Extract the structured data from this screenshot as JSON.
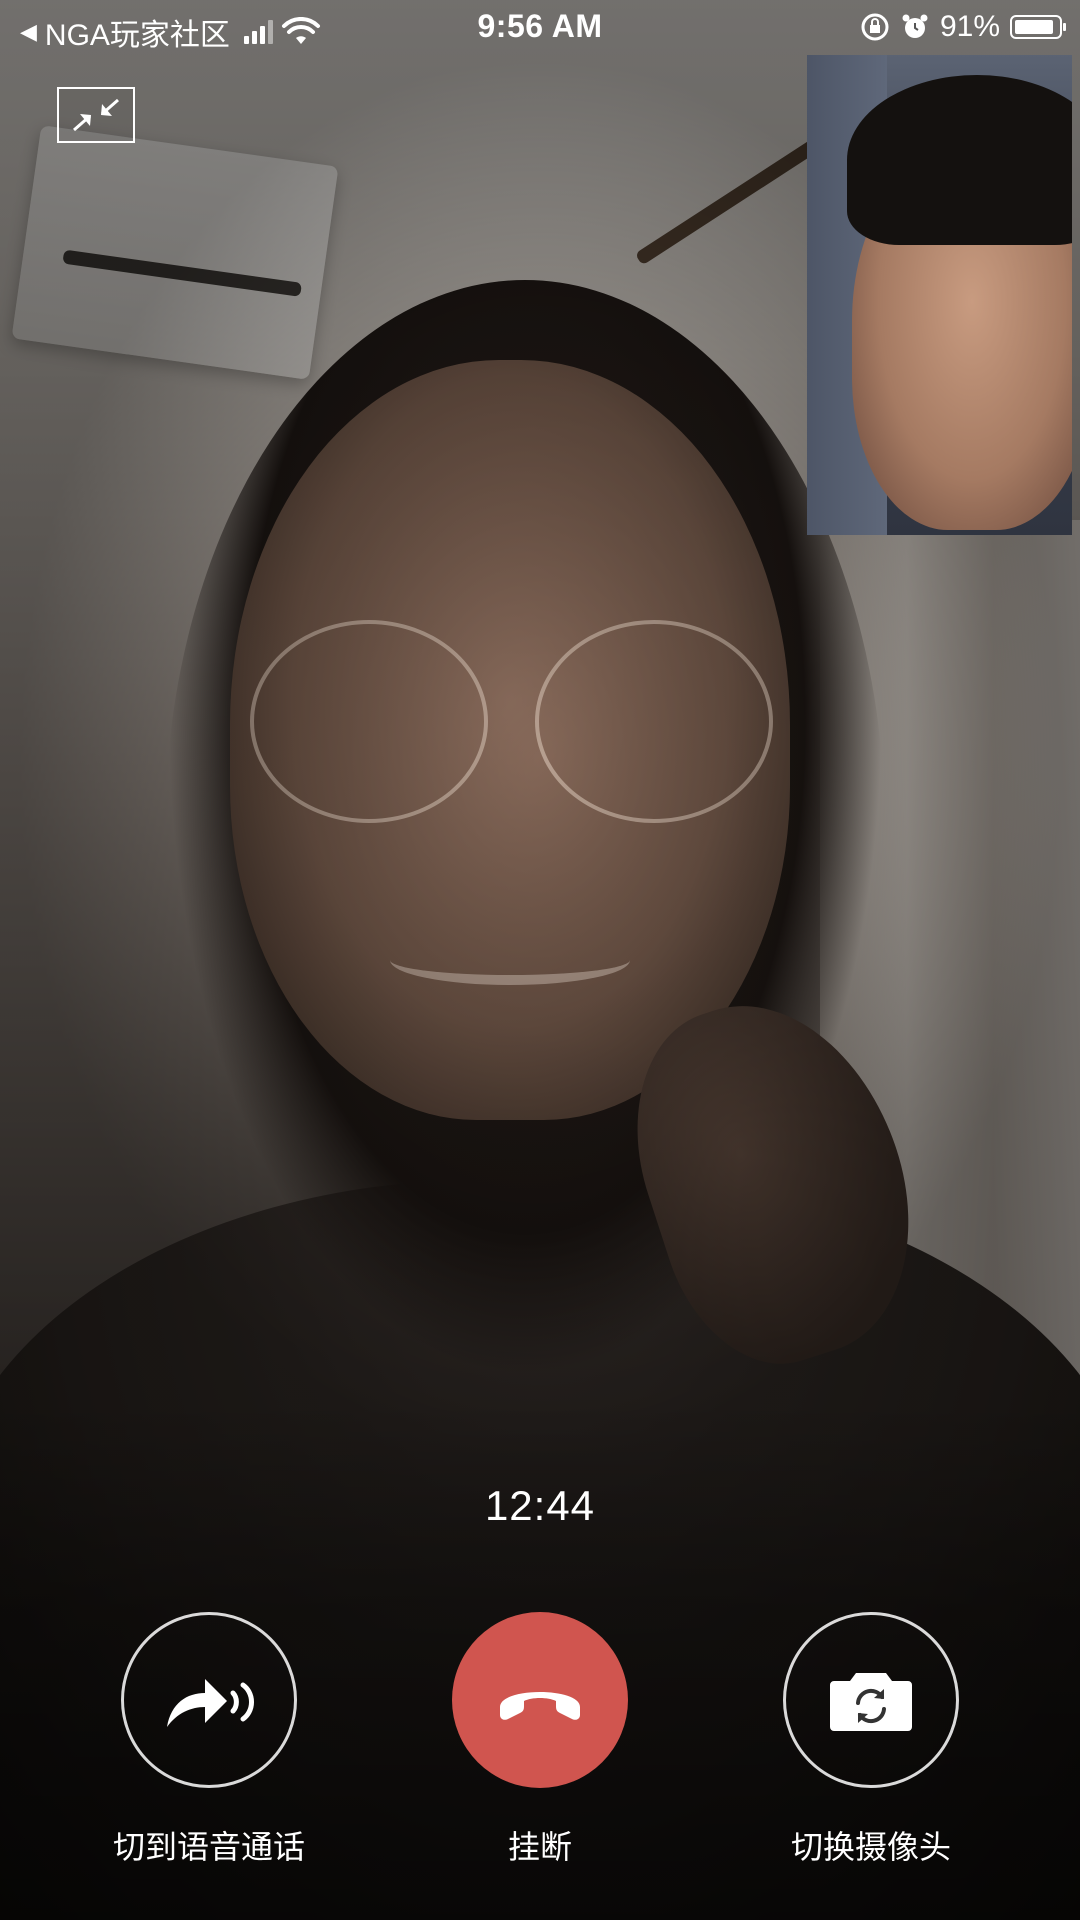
{
  "status_bar": {
    "back_app": "NGA玩家社区",
    "time": "9:56 AM",
    "battery": "91%",
    "battery_level": 0.91
  },
  "call": {
    "timer": "12:44"
  },
  "controls": {
    "switch_voice": "切到语音通话",
    "hangup": "挂断",
    "switch_camera": "切换摄像头"
  },
  "colors": {
    "hangup": "#d0554f"
  },
  "icons": {
    "back": "back-arrow-icon",
    "signal": "cellular-signal-icon",
    "wifi": "wifi-icon",
    "rotation_lock": "rotation-lock-icon",
    "alarm": "alarm-icon",
    "battery": "battery-icon",
    "minimize": "minimize-arrows-icon",
    "voice_call": "voice-call-arrow-icon",
    "hangup": "phone-hangup-icon",
    "camera_switch": "camera-switch-icon"
  }
}
